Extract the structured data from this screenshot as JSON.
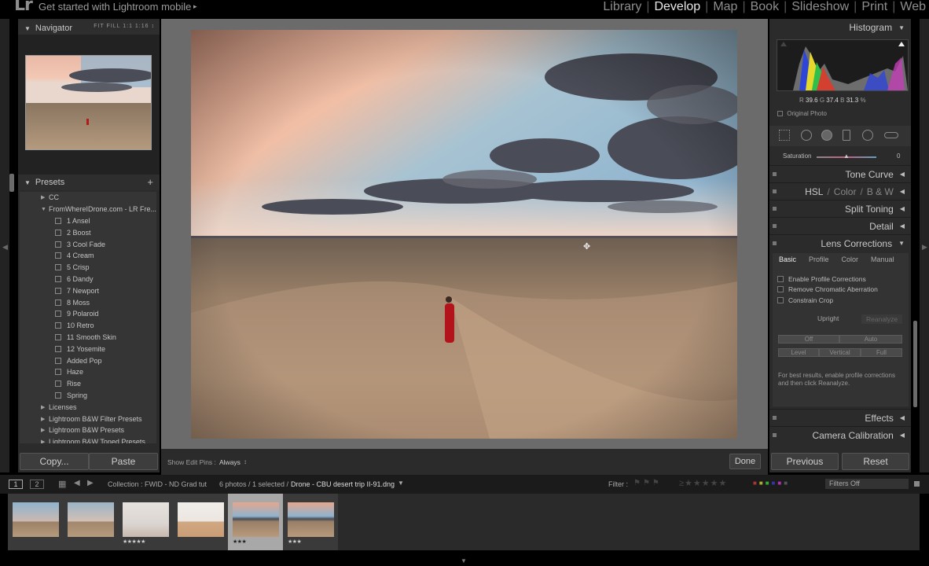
{
  "app": {
    "logo": "Lr",
    "get_started": "Get started with Lightroom mobile",
    "get_started_arrow": "▸"
  },
  "modules": [
    "Library",
    "Develop",
    "Map",
    "Book",
    "Slideshow",
    "Print",
    "Web"
  ],
  "active_module": "Develop",
  "navigator": {
    "title": "Navigator",
    "zoom_options": "FIT   FILL   1:1   1:16 ↕"
  },
  "presets": {
    "title": "Presets",
    "add_icon": "+",
    "items": [
      {
        "label": "CC",
        "type": "folder",
        "indent": 0
      },
      {
        "label": "FromWhereIDrone.com - LR Fre...",
        "type": "folder-open",
        "indent": 0
      },
      {
        "label": "1 Ansel",
        "type": "preset",
        "indent": 1
      },
      {
        "label": "2 Boost",
        "type": "preset",
        "indent": 1
      },
      {
        "label": "3 Cool Fade",
        "type": "preset",
        "indent": 1
      },
      {
        "label": "4 Cream",
        "type": "preset",
        "indent": 1
      },
      {
        "label": "5 Crisp",
        "type": "preset",
        "indent": 1
      },
      {
        "label": "6 Dandy",
        "type": "preset",
        "indent": 1
      },
      {
        "label": "7 Newport",
        "type": "preset",
        "indent": 1
      },
      {
        "label": "8 Moss",
        "type": "preset",
        "indent": 1
      },
      {
        "label": "9 Polaroid",
        "type": "preset",
        "indent": 1
      },
      {
        "label": "10 Retro",
        "type": "preset",
        "indent": 1
      },
      {
        "label": "11 Smooth Skin",
        "type": "preset",
        "indent": 1
      },
      {
        "label": "12 Yosemite",
        "type": "preset",
        "indent": 1
      },
      {
        "label": "Added Pop",
        "type": "preset",
        "indent": 1
      },
      {
        "label": "Haze",
        "type": "preset",
        "indent": 1
      },
      {
        "label": "Rise",
        "type": "preset",
        "indent": 1
      },
      {
        "label": "Spring",
        "type": "preset",
        "indent": 1
      },
      {
        "label": "Licenses",
        "type": "folder",
        "indent": 0
      },
      {
        "label": "Lightroom B&W Filter Presets",
        "type": "folder",
        "indent": 0
      },
      {
        "label": "Lightroom B&W Presets",
        "type": "folder",
        "indent": 0
      },
      {
        "label": "Lightroom B&W Toned Presets",
        "type": "folder",
        "indent": 0
      }
    ]
  },
  "left_buttons": {
    "copy": "Copy...",
    "paste": "Paste"
  },
  "toolbar": {
    "edit_pins_label": "Show Edit Pins :",
    "edit_pins_value": "Always",
    "edit_pins_arrow": "↕",
    "done": "Done"
  },
  "histogram": {
    "title": "Histogram",
    "r_label": "R",
    "r_value": "39.6",
    "g_label": "G",
    "g_value": "37.4",
    "b_label": "B",
    "b_value": "31.3",
    "percent": "%",
    "original_photo": "Original Photo"
  },
  "saturation": {
    "label": "Saturation",
    "value": "0"
  },
  "sections": {
    "tone_curve": "Tone Curve",
    "hsl": "HSL",
    "hsl_sep": "/",
    "color": "Color",
    "bw": "B & W",
    "split_toning": "Split Toning",
    "detail": "Detail",
    "lens_corrections": "Lens Corrections",
    "effects": "Effects",
    "camera_calibration": "Camera Calibration"
  },
  "lens": {
    "tabs": [
      "Basic",
      "Profile",
      "Color",
      "Manual"
    ],
    "active_tab": "Basic",
    "enable_profile": "Enable Profile Corrections",
    "remove_ca": "Remove Chromatic Aberration",
    "constrain_crop": "Constrain Crop",
    "upright": "Upright",
    "reanalyze": "Reanalyze",
    "off": "Off",
    "auto": "Auto",
    "level": "Level",
    "vertical": "Vertical",
    "full": "Full",
    "note": "For best results, enable profile corrections and then click Reanalyze."
  },
  "right_buttons": {
    "previous": "Previous",
    "reset": "Reset"
  },
  "filmstrip_bar": {
    "view1": "1",
    "view2": "2",
    "collection": "Collection : FWID - ND Grad tut",
    "count": "6 photos / 1 selected /",
    "filename": "Drone - CBU desert trip II-91.dng",
    "filter_label": "Filter :",
    "filters_off": "Filters Off"
  },
  "thumbnails": [
    {
      "stars": "",
      "selected": false
    },
    {
      "stars": "",
      "selected": false
    },
    {
      "stars": "★★★★★",
      "selected": false
    },
    {
      "stars": "",
      "selected": false
    },
    {
      "stars": "★★★",
      "selected": true
    },
    {
      "stars": "★★★",
      "selected": false
    }
  ]
}
